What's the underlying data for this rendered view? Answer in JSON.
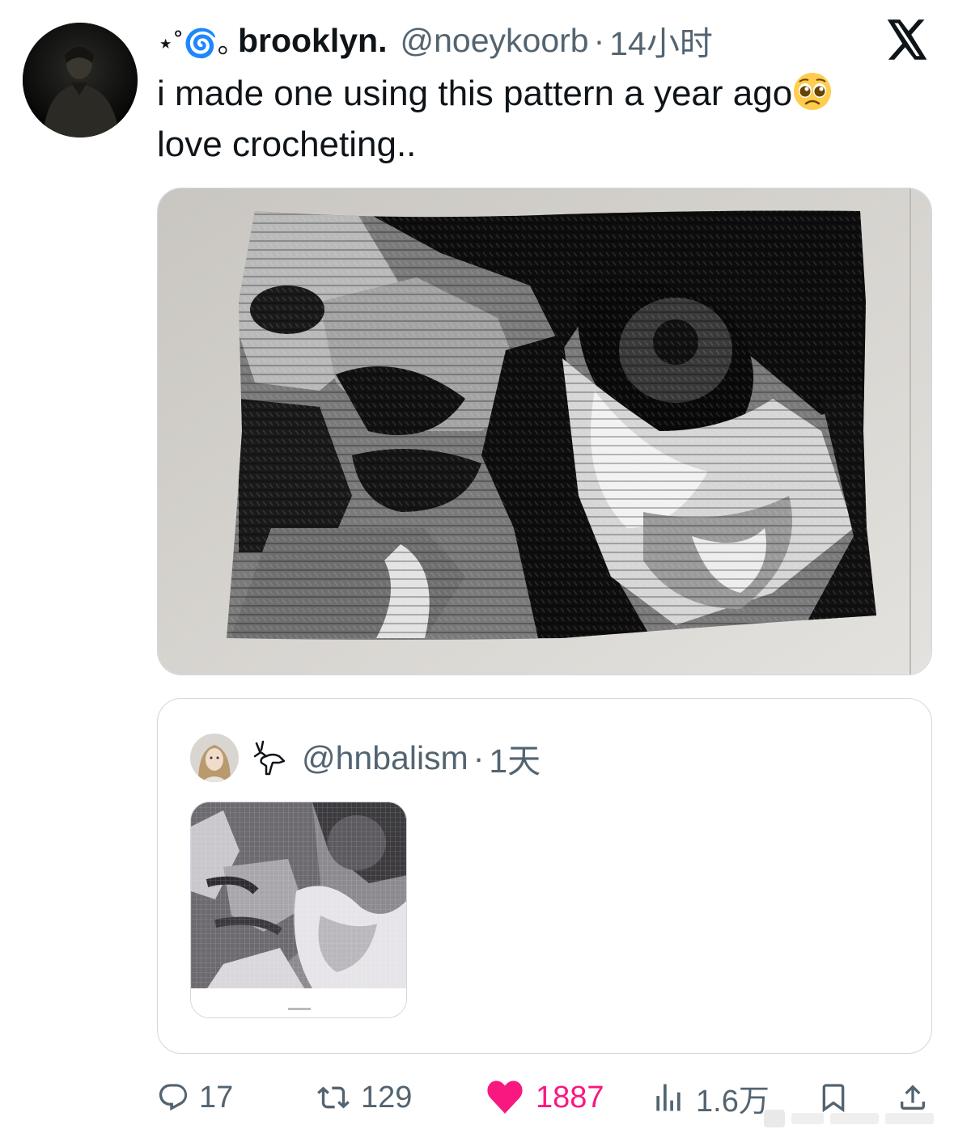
{
  "tweet": {
    "name_deco": "⋆˚🌀｡",
    "display_name": "brooklyn.",
    "handle": "@noeykoorb",
    "separator": "·",
    "time": "14小时",
    "text_line1": "i made one using this pattern a year ago",
    "text_line2": "love crocheting..",
    "emoji": "pleading-face-emoji",
    "media_description_icon": "crochet-blanket-photo"
  },
  "quote": {
    "handle": "@hnbalism",
    "separator": "·",
    "time": "1天",
    "name_emoji": "deer-icon",
    "media_icon": "crochet-pattern-chart"
  },
  "actions": {
    "replies": "17",
    "retweets": "129",
    "likes": "1887",
    "views": "1.6万"
  },
  "colors": {
    "text": "#0f1419",
    "secondary": "#536471",
    "like": "#f91880",
    "border": "#cfd9de"
  }
}
